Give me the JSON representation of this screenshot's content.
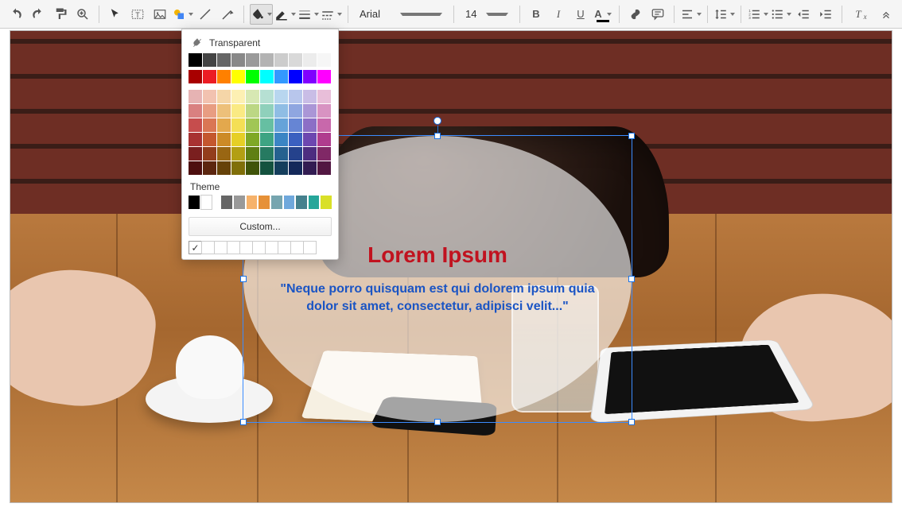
{
  "toolbar": {
    "font_name": "Arial",
    "font_size": "14",
    "bold": "B",
    "italic": "I",
    "underline": "U",
    "font_color": "A"
  },
  "color_picker": {
    "transparent_label": "Transparent",
    "theme_label": "Theme",
    "custom_label": "Custom...",
    "greys": [
      "#000000",
      "#444444",
      "#666666",
      "#888888",
      "#9a9a9a",
      "#b3b3b3",
      "#cccccc",
      "#d9d9d9",
      "#ececec",
      "#f6f6f6"
    ],
    "hues": [
      "#a80000",
      "#ec1c24",
      "#ff8000",
      "#ffff00",
      "#00ff00",
      "#00ffff",
      "#3399ff",
      "#0000ff",
      "#8000ff",
      "#ff00ff"
    ],
    "main": [
      [
        "#e6b3b3",
        "#f2c2b0",
        "#f5d6a8",
        "#fdf0b3",
        "#d7e8b3",
        "#b6e0d3",
        "#b8d6ef",
        "#b8c6ec",
        "#c9bde6",
        "#e8bed9"
      ],
      [
        "#d98080",
        "#e89d82",
        "#edc07a",
        "#faea84",
        "#bcd784",
        "#8fd0bb",
        "#8fbde4",
        "#8fa6e0",
        "#aa96d6",
        "#d893c2"
      ],
      [
        "#c64d4d",
        "#da7654",
        "#e3a84d",
        "#f4df55",
        "#a1c655",
        "#66bfa2",
        "#66a3d9",
        "#6685d4",
        "#8c6fc6",
        "#c868ab"
      ],
      [
        "#a83232",
        "#c4572e",
        "#cc8a26",
        "#e6cf26",
        "#7fa826",
        "#3da483",
        "#3b85c4",
        "#3b60c0",
        "#6d47b0",
        "#b03c8e"
      ],
      [
        "#7a1f1f",
        "#933d1c",
        "#996613",
        "#b39f13",
        "#5f7f13",
        "#267a61",
        "#25618f",
        "#25428c",
        "#4d2d80",
        "#802866"
      ],
      [
        "#4d0f0f",
        "#5c260f",
        "#664209",
        "#806f09",
        "#405409",
        "#14523f",
        "#143e5c",
        "#14295a",
        "#321c52",
        "#521742"
      ]
    ],
    "theme_colors": [
      "#000000",
      "#ffffff",
      "#666666",
      "#999999",
      "#f6b26b",
      "#e69138",
      "#76a5af",
      "#6fa8dc",
      "#45818e",
      "#26a69a",
      "#d9e028"
    ],
    "recent_checked": "✓"
  },
  "slide": {
    "title": "Lorem Ipsum",
    "subtitle": "\"Neque porro quisquam est qui dolorem ipsum quia dolor sit amet, consectetur, adipisci velit...\""
  }
}
